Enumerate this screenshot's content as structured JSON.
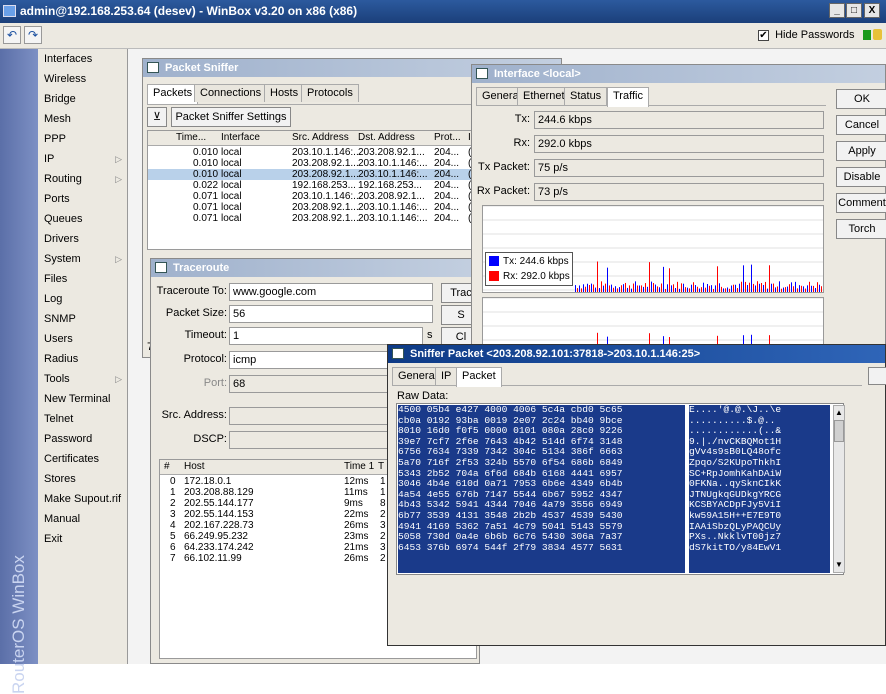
{
  "titlebar": {
    "title": "admin@192.168.253.64 (desev) - WinBox v3.20 on x86 (x86)",
    "min": "_",
    "max": "□",
    "close": "X"
  },
  "toolbar": {
    "undo_icon": "undo-icon",
    "redo_icon": "redo-icon",
    "hide_passwords_label": "Hide Passwords",
    "hide_passwords_checked": "✔"
  },
  "vband": {
    "text": "RouterOS WinBox"
  },
  "menu": [
    {
      "label": "Interfaces"
    },
    {
      "label": "Wireless"
    },
    {
      "label": "Bridge"
    },
    {
      "label": "Mesh"
    },
    {
      "label": "PPP"
    },
    {
      "label": "IP",
      "arrow": "▷"
    },
    {
      "label": "Routing",
      "arrow": "▷"
    },
    {
      "label": "Ports"
    },
    {
      "label": "Queues"
    },
    {
      "label": "Drivers"
    },
    {
      "label": "System",
      "arrow": "▷"
    },
    {
      "label": "Files"
    },
    {
      "label": "Log"
    },
    {
      "label": "SNMP"
    },
    {
      "label": "Users"
    },
    {
      "label": "Radius"
    },
    {
      "label": "Tools",
      "arrow": "▷"
    },
    {
      "label": "New Terminal"
    },
    {
      "label": "Telnet"
    },
    {
      "label": "Password"
    },
    {
      "label": "Certificates"
    },
    {
      "label": "Stores"
    },
    {
      "label": "Make Supout.rif"
    },
    {
      "label": "Manual"
    },
    {
      "label": "Exit"
    }
  ],
  "sniffer": {
    "title": "Packet Sniffer",
    "tabs": [
      "Packets",
      "Connections",
      "Hosts",
      "Protocols"
    ],
    "settings_btn": "Packet Sniffer Settings",
    "columns": [
      "Time...",
      "Interface",
      "Src. Address",
      "Dst. Address",
      "Prot...",
      "IP"
    ],
    "rows": [
      [
        "0.010",
        "local",
        "203.10.1.146:...",
        "203.208.92.1...",
        "204...",
        "("
      ],
      [
        "0.010",
        "local",
        "203.208.92.1...",
        "203.10.1.146:...",
        "204...",
        "("
      ],
      [
        "0.010",
        "local",
        "203.208.92.1...",
        "203.10.1.146:...",
        "204...",
        "("
      ],
      [
        "0.022",
        "local",
        "192.168.253...",
        "192.168.253...",
        "204...",
        "("
      ],
      [
        "0.071",
        "local",
        "203.10.1.146:...",
        "203.208.92.1...",
        "204...",
        "("
      ],
      [
        "0.071",
        "local",
        "203.208.92.1...",
        "203.10.1.146:...",
        "204...",
        "("
      ],
      [
        "0.071",
        "local",
        "203.208.92.1...",
        "203.10.1.146:...",
        "204...",
        "("
      ]
    ],
    "status_fragment": "7"
  },
  "traceroute": {
    "title": "Traceroute",
    "to_label": "Traceroute To:",
    "to_value": "www.google.com",
    "size_label": "Packet Size:",
    "size_value": "56",
    "timeout_label": "Timeout:",
    "timeout_value": "1",
    "timeout_unit": "s",
    "protocol_label": "Protocol:",
    "protocol_value": "icmp",
    "port_label": "Port:",
    "port_value": "68",
    "src_label": "Src. Address:",
    "dscp_label": "DSCP:",
    "btn_trace": "Trac",
    "btn_s": "S",
    "btn_c": "Cl",
    "columns": [
      "#",
      "Host",
      "Time 1",
      "T"
    ],
    "rows": [
      [
        "0",
        "172.18.0.1",
        "12ms",
        "1"
      ],
      [
        "1",
        "203.208.88.129",
        "11ms",
        "1"
      ],
      [
        "2",
        "202.55.144.177",
        "9ms",
        "8"
      ],
      [
        "3",
        "202.55.144.153",
        "22ms",
        "2"
      ],
      [
        "4",
        "202.167.228.73",
        "26ms",
        "3"
      ],
      [
        "5",
        "66.249.95.232",
        "23ms",
        "2"
      ],
      [
        "6",
        "64.233.174.242",
        "21ms",
        "3"
      ],
      [
        "7",
        "66.102.11.99",
        "26ms",
        "2"
      ]
    ]
  },
  "iface": {
    "title": "Interface <local>",
    "tabs": [
      "General",
      "Ethernet",
      "Status",
      "Traffic"
    ],
    "tx_label": "Tx:",
    "tx_value": "244.6 kbps",
    "rx_label": "Rx:",
    "rx_value": "292.0 kbps",
    "txp_label": "Tx Packet:",
    "txp_value": "75 p/s",
    "rxp_label": "Rx Packet:",
    "rxp_value": "73 p/s",
    "legend_tx": "Tx:  244.6 kbps",
    "legend_rx": "Rx:  292.0 kbps",
    "tx_color": "#0000ff",
    "rx_color": "#ff0000",
    "buttons": [
      "OK",
      "Cancel",
      "Apply",
      "Disable",
      "Comment",
      "Torch"
    ]
  },
  "spkt": {
    "title": "Sniffer Packet <203.208.92.101:37818->203.10.1.146:25>",
    "tabs": [
      "General",
      "IP",
      "Packet"
    ],
    "raw_label": "Raw Data:",
    "hex": [
      "4500 05b4 e427 4000 4006 5c4a cbd0 5c65",
      "cb0a 0192 93ba 0019 2e07 2c24 bb40 9bce",
      "8010 16d0 f0f5 0000 0101 080a 28c0 9226",
      "39e7 7cf7 2f6e 7643 4b42 514d 6f74 3148",
      "6756 7634 7339 7342 304c 5134 386f 6663",
      "5a70 716f 2f53 324b 5570 6f54 686b 6849",
      "5343 2b52 704a 6f6d 684b 6168 4441 6957",
      "3046 4b4e 610d 0a71 7953 6b6e 4349 6b4b",
      "4a54 4e55 676b 7147 5544 6b67 5952 4347",
      "4b43 5342 5941 4344 7046 4a79 3556 6949",
      "6b77 3539 4131 3548 2b2b 4537 4539 5430",
      "4941 4169 5362 7a51 4c79 5041 5143 5579",
      "5058 730d 0a4e 6b6b 6c76 5430 306a 7a37",
      "6453 376b 6974 544f 2f79 3834 4577 5631"
    ],
    "ascii": [
      "E....'@.@.\\J..\\e",
      "..........$.@..",
      "............(..&",
      "9.|./nvCKBQMot1H",
      "gVv4s9sB0LQ48ofc",
      "Zpqo/S2KUpoThkhI",
      "SC+RpJomhKahDAiW",
      "0FKNa..qySknCIkK",
      "JTNUgkqGUDkgYRCG",
      "KCSBYACDpFJy5ViI",
      "kw59A15H++E7E9T0",
      "IAAiSbzQLyPAQCUy",
      "PXs..NkklvT00jz7",
      "dS7kitTO/y84EwV1"
    ]
  }
}
